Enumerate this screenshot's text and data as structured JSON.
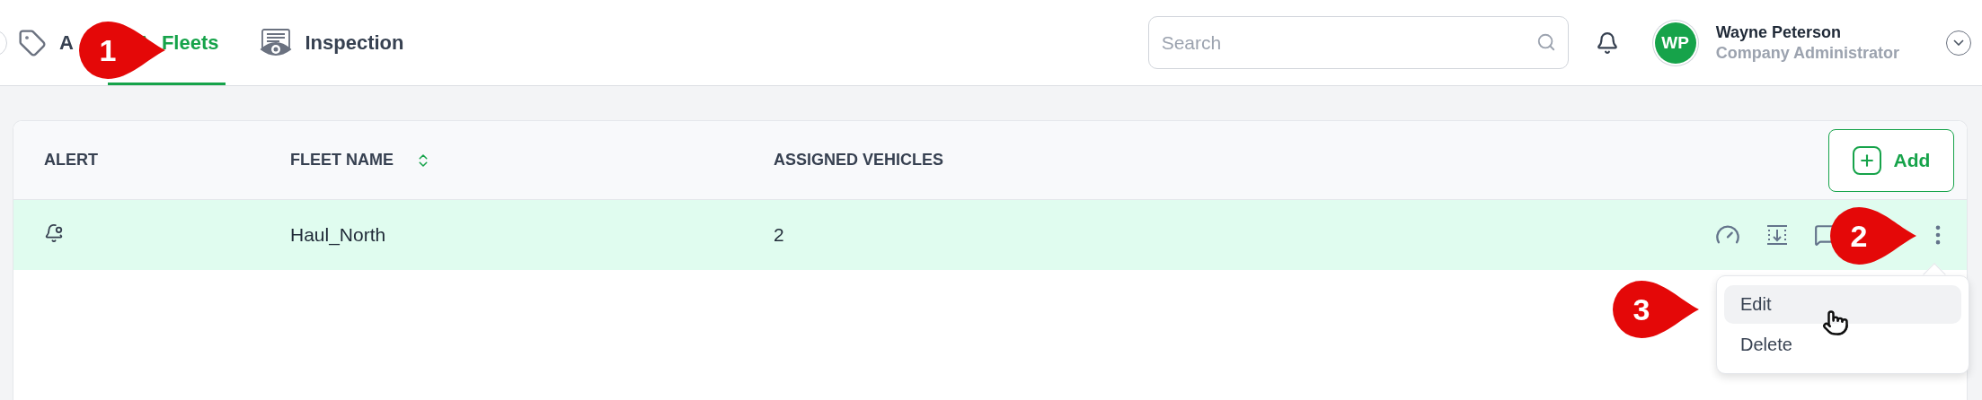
{
  "nav": {
    "tabs": [
      {
        "label": "A",
        "selected": false
      },
      {
        "label": "Fleets",
        "selected": true
      },
      {
        "label": "Inspection",
        "selected": false
      }
    ]
  },
  "search": {
    "placeholder": "Search"
  },
  "user": {
    "initials": "WP",
    "name": "Wayne Peterson",
    "role": "Company Administrator"
  },
  "table": {
    "columns": [
      {
        "label": "ALERT",
        "sortable": false
      },
      {
        "label": "FLEET NAME",
        "sortable": true
      },
      {
        "label": "ASSIGNED VEHICLES",
        "sortable": false
      }
    ],
    "add_button": "Add",
    "rows": [
      {
        "cells": [
          "",
          "Haul_North",
          "2"
        ],
        "selected": true
      }
    ]
  },
  "menu": {
    "items": [
      {
        "label": "Edit",
        "selected": true
      },
      {
        "label": "Delete",
        "selected": false
      }
    ]
  },
  "callouts": [
    {
      "number": "1"
    },
    {
      "number": "2"
    },
    {
      "number": "3"
    }
  ]
}
